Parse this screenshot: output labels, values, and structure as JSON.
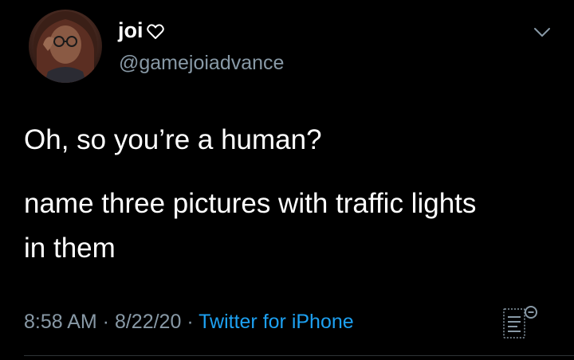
{
  "author": {
    "display_name": "joi",
    "handle": "@gamejoiadvance",
    "name_emoji": "heart-outline-icon"
  },
  "tweet": {
    "lines": [
      "Oh, so you’re a human?",
      "name three pictures with traffic lights",
      "in them"
    ]
  },
  "meta": {
    "time": "8:58 AM",
    "separator": " · ",
    "date": "8/22/20",
    "source": "Twitter for iPhone"
  },
  "colors": {
    "background": "#000000",
    "text": "#ffffff",
    "secondary": "#8899a6",
    "link": "#1da1f2"
  }
}
